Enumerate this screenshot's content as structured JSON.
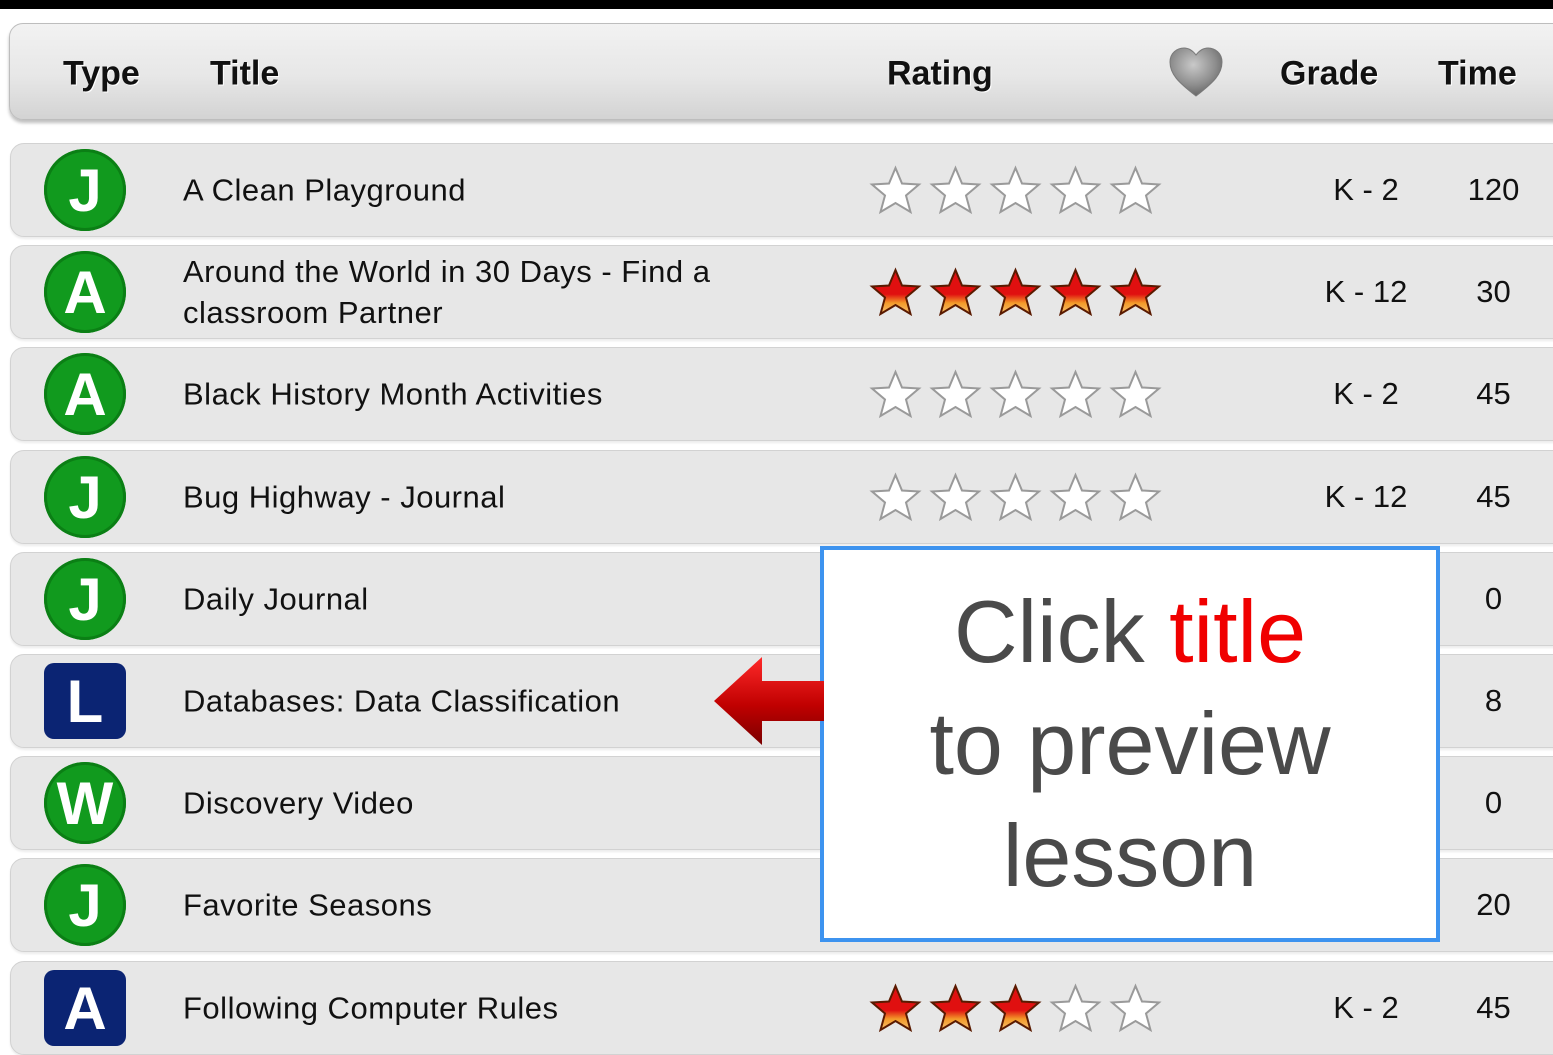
{
  "header": {
    "type_label": "Type",
    "title_label": "Title",
    "rating_label": "Rating",
    "favorite_icon": "heart-icon",
    "grade_label": "Grade",
    "time_label": "Time"
  },
  "rows": [
    {
      "type": "J",
      "type_shape": "circle",
      "title": "A Clean Playground",
      "rating": 0,
      "grade": "K - 2",
      "time": "120"
    },
    {
      "type": "A",
      "type_shape": "circle",
      "title": "Around the World in 30 Days - Find a classroom Partner",
      "rating": 5,
      "grade": "K - 12",
      "time": "30"
    },
    {
      "type": "A",
      "type_shape": "circle",
      "title": "Black History Month Activities",
      "rating": 0,
      "grade": "K - 2",
      "time": "45"
    },
    {
      "type": "J",
      "type_shape": "circle",
      "title": "Bug Highway - Journal",
      "rating": 0,
      "grade": "K - 12",
      "time": "45"
    },
    {
      "type": "J",
      "type_shape": "circle",
      "title": "Daily Journal",
      "rating": null,
      "grade": "",
      "time": "0"
    },
    {
      "type": "L",
      "type_shape": "square",
      "title": "Databases: Data Classification",
      "rating": null,
      "grade": "",
      "time": "8"
    },
    {
      "type": "W",
      "type_shape": "circle",
      "title": "Discovery Video",
      "rating": null,
      "grade": "",
      "time": "0"
    },
    {
      "type": "J",
      "type_shape": "circle",
      "title": "Favorite Seasons",
      "rating": null,
      "grade": "",
      "time": "20"
    },
    {
      "type": "A",
      "type_shape": "square",
      "title": "Following Computer Rules",
      "rating": 3,
      "grade": "K - 2",
      "time": "45"
    }
  ],
  "callout": {
    "line1_prefix": "Click ",
    "line1_highlight": "title",
    "line2": "to preview",
    "line3": "lesson"
  },
  "colors": {
    "type_circle": "#119a1e",
    "type_square": "#0b2473",
    "star_filled": "#e01010",
    "callout_border": "#3d93ef",
    "callout_highlight": "#f00000",
    "arrow": "#c80000"
  }
}
